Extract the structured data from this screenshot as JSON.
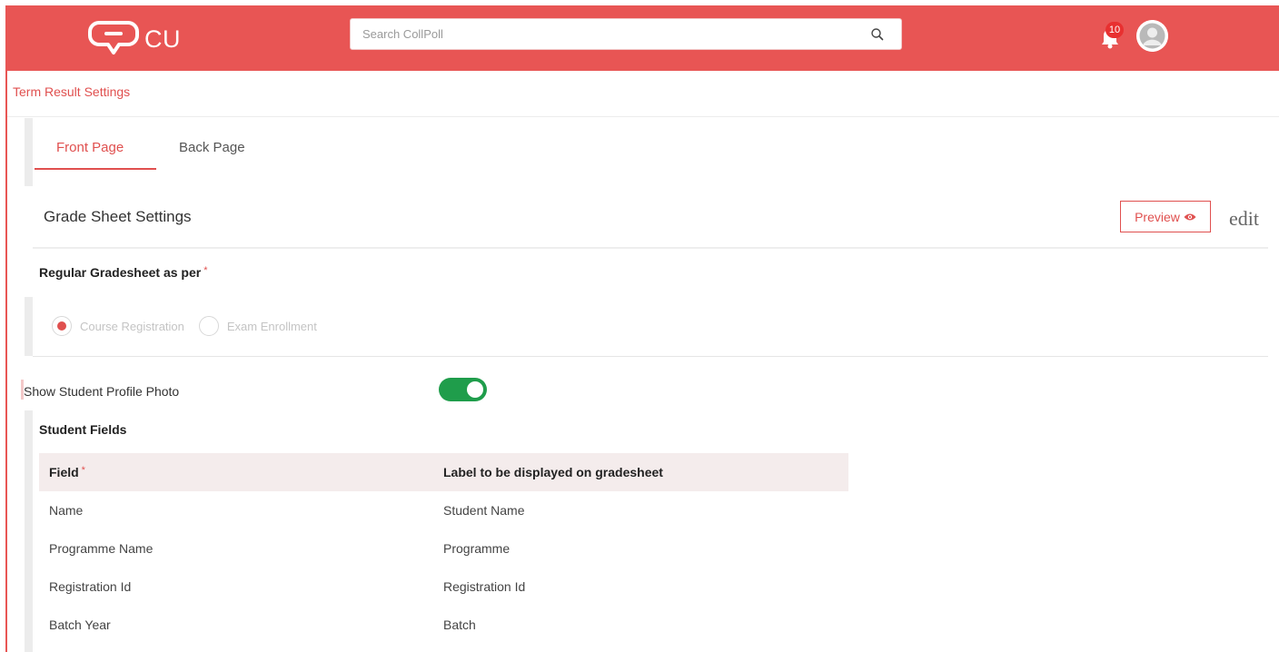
{
  "header": {
    "logo_text": "CU",
    "search_placeholder": "Search CollPoll",
    "notification_count": "10",
    "brand_color": "#e85554"
  },
  "breadcrumb": "Term Result Settings",
  "tabs": [
    {
      "label": "Front Page",
      "active": true
    },
    {
      "label": "Back Page",
      "active": false
    }
  ],
  "grade_sheet": {
    "title": "Grade Sheet Settings",
    "preview_label": "Preview",
    "edit_label": "edit"
  },
  "regular_gradesheet": {
    "label": "Regular Gradesheet as per",
    "required_mark": "*",
    "options": [
      {
        "label": "Course Registration",
        "checked": true
      },
      {
        "label": "Exam Enrollment",
        "checked": false
      }
    ]
  },
  "profile_photo": {
    "label": "Show Student Profile Photo",
    "enabled": true
  },
  "student_fields": {
    "title": "Student Fields",
    "columns": [
      "Field",
      "Label to be displayed on gradesheet"
    ],
    "field_required_mark": "*",
    "rows": [
      [
        "Name",
        "Student Name"
      ],
      [
        "Programme Name",
        "Programme"
      ],
      [
        "Registration Id",
        "Registration Id"
      ],
      [
        "Batch Year",
        "Batch"
      ]
    ]
  },
  "icons": {
    "logo": "speech-bubble-logo-icon",
    "search": "search-icon",
    "notifications": "bell-icon",
    "avatar": "user-avatar-icon",
    "preview": "eye-icon"
  }
}
